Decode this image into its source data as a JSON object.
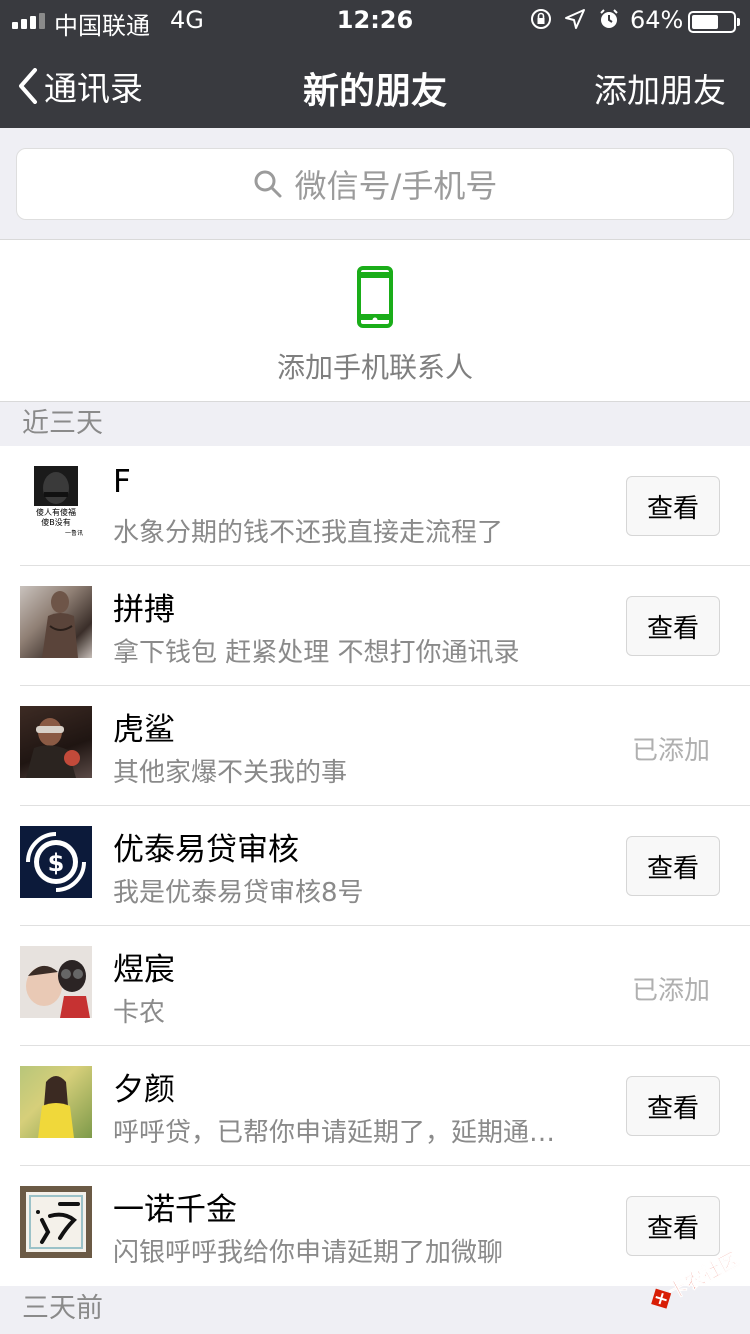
{
  "status_bar": {
    "carrier": "中国联通",
    "network": "4G",
    "time": "12:26",
    "battery": "64%",
    "battery_level": 0.64
  },
  "nav": {
    "back_label": "通讯录",
    "title": "新的朋友",
    "action_label": "添加朋友"
  },
  "search": {
    "placeholder": "微信号/手机号"
  },
  "add_phone": {
    "label": "添加手机联系人",
    "icon_color": "#1aad19"
  },
  "sections": {
    "recent": "近三天",
    "older": "三天前"
  },
  "friends": [
    {
      "name": "F",
      "message": "水象分期的钱不还我直接走流程了",
      "status": "查看",
      "action": "view",
      "avatar_caption": [
        "傻人有傻福",
        "傻B没有",
        "一鲁讯"
      ]
    },
    {
      "name": "拼搏",
      "message": "拿下钱包 赶紧处理 不想打你通讯录",
      "status": "查看",
      "action": "view"
    },
    {
      "name": "虎鲨",
      "message": "其他家爆不关我的事",
      "status": "已添加",
      "action": "added"
    },
    {
      "name": "优泰易贷审核",
      "message": "我是优泰易贷审核8号",
      "status": "查看",
      "action": "view"
    },
    {
      "name": "煜宸",
      "message": "卡农",
      "status": "已添加",
      "action": "added"
    },
    {
      "name": "夕颜",
      "message": "呼呼贷，已帮你申请延期了，延期通…",
      "status": "查看",
      "action": "view"
    },
    {
      "name": "一诺千金",
      "message": "闪银呼呼我给你申请延期了加微聊",
      "status": "查看",
      "action": "view"
    }
  ],
  "watermark": "卡农社区",
  "colors": {
    "nav_bg": "#393a3f",
    "page_bg": "#efeff4",
    "accent_green": "#1aad19",
    "watermark_red": "#d81e06"
  }
}
